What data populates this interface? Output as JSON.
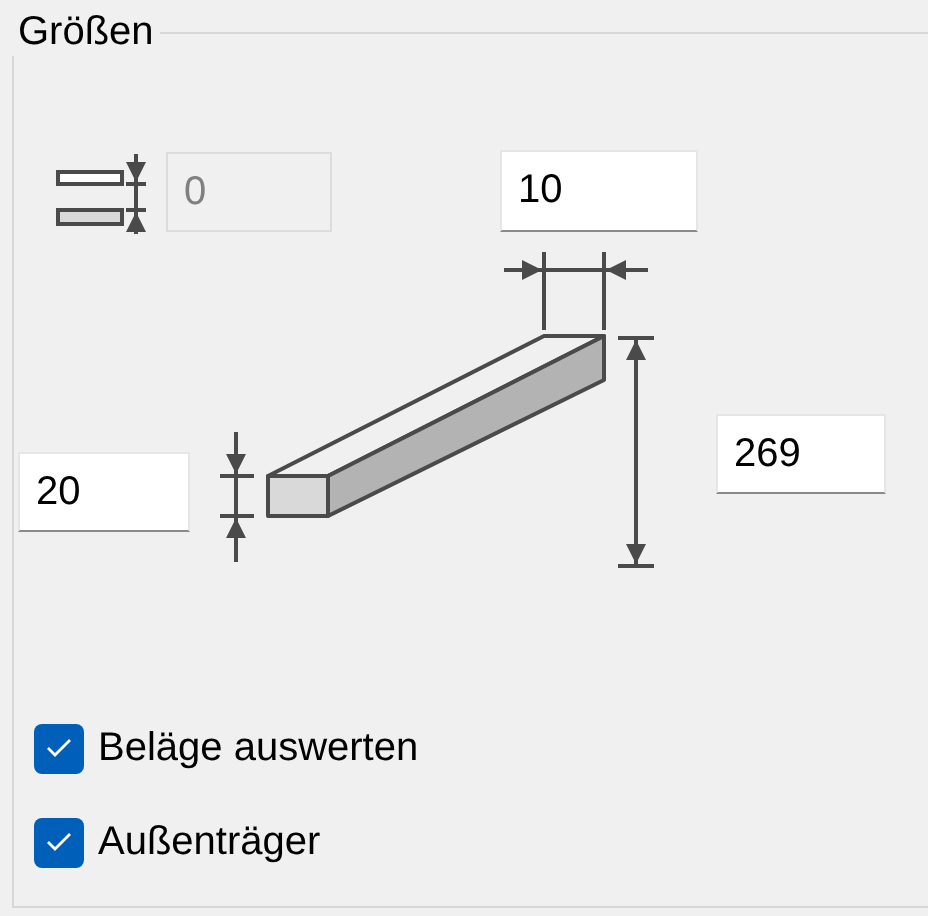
{
  "group": {
    "title": "Größen"
  },
  "fields": [
    {
      "kind": "gap",
      "value": "0",
      "disabled": true
    },
    {
      "kind": "width",
      "value": "10",
      "disabled": false
    },
    {
      "kind": "height",
      "value": "20",
      "disabled": false
    },
    {
      "kind": "length",
      "value": "269",
      "disabled": false
    }
  ],
  "checkboxes": [
    {
      "label": "Beläge auswerten",
      "checked": true
    },
    {
      "label": "Außenträger",
      "checked": true
    }
  ]
}
